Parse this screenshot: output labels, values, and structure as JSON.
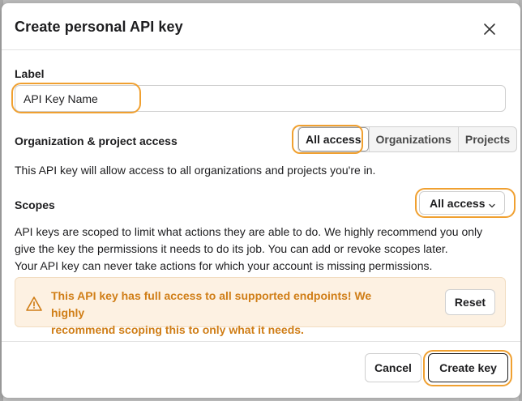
{
  "dialog": {
    "title": "Create personal API key",
    "close_icon": "close-icon"
  },
  "label_section": {
    "heading": "Label",
    "input_value": "API Key Name"
  },
  "access_section": {
    "heading": "Organization & project access",
    "options": [
      "All access",
      "Organizations",
      "Projects"
    ],
    "selected": "All access",
    "description": "This API key will allow access to all organizations and projects you're in."
  },
  "scopes_section": {
    "heading": "Scopes",
    "select_value": "All access",
    "chevron_icon": "chevron-down-icon",
    "description_lines": [
      "API keys are scoped to limit what actions they are able to do. We highly recommend you only",
      "give the key the permissions it needs to do its job. You can add or revoke scopes later.",
      "Your API key can never take actions for which your account is missing permissions."
    ]
  },
  "warning": {
    "icon": "warning-triangle-icon",
    "text_line1": "This API key has full access to all supported endpoints! We highly",
    "text_line2": "recommend scoping this to only what it needs.",
    "reset_label": "Reset",
    "color": "#d07e17",
    "background": "#fdf1e2"
  },
  "footer": {
    "cancel_label": "Cancel",
    "create_label": "Create key"
  },
  "colors": {
    "highlight": "#f0a030"
  }
}
